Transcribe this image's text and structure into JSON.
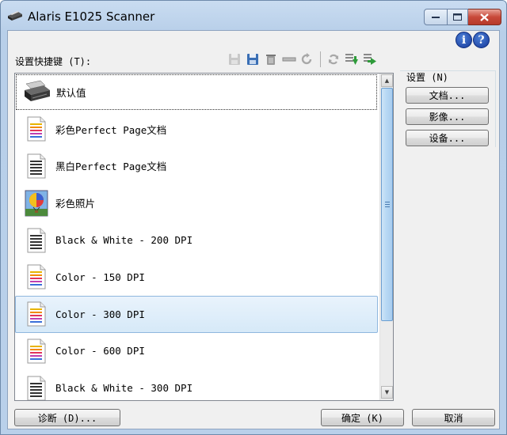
{
  "window": {
    "title": "Alaris E1025 Scanner"
  },
  "help": {
    "info_glyph": "i",
    "help_glyph": "?"
  },
  "shortcuts": {
    "label": "设置快捷键 (T):",
    "items": [
      {
        "label": "默认值",
        "icon": "scanner-icon"
      },
      {
        "label": "彩色Perfect Page文档",
        "icon": "color-document-icon"
      },
      {
        "label": "黑白Perfect Page文档",
        "icon": "bw-document-icon"
      },
      {
        "label": "彩色照片",
        "icon": "color-photo-icon"
      },
      {
        "label": "Black & White - 200 DPI",
        "icon": "bw-document-icon"
      },
      {
        "label": "Color - 150 DPI",
        "icon": "color-document-icon"
      },
      {
        "label": "Color - 300 DPI",
        "icon": "color-document-icon"
      },
      {
        "label": "Color - 600 DPI",
        "icon": "color-document-icon"
      },
      {
        "label": "Black & White - 300 DPI",
        "icon": "bw-document-icon"
      }
    ],
    "selected_index": 6
  },
  "toolbar": {
    "icons": [
      "save-icon",
      "save-as-icon",
      "delete-icon",
      "rename-icon",
      "undo-icon",
      "refresh-icon",
      "import-icon",
      "export-icon"
    ]
  },
  "settings": {
    "label": "设置 (N)",
    "document_button": "文档...",
    "image_button": "影像...",
    "device_button": "设备..."
  },
  "footer": {
    "diagnostics_button": "诊断 (D)...",
    "ok_button": "确定 (K)",
    "cancel_button": "取消"
  },
  "colors": {
    "titlebar": "#b9d0ea",
    "client_bg": "#f0f0f0",
    "selection": "#d6e9f8",
    "help_icon": "#1e4bb5",
    "toolbar_green": "#2e9b3a"
  }
}
